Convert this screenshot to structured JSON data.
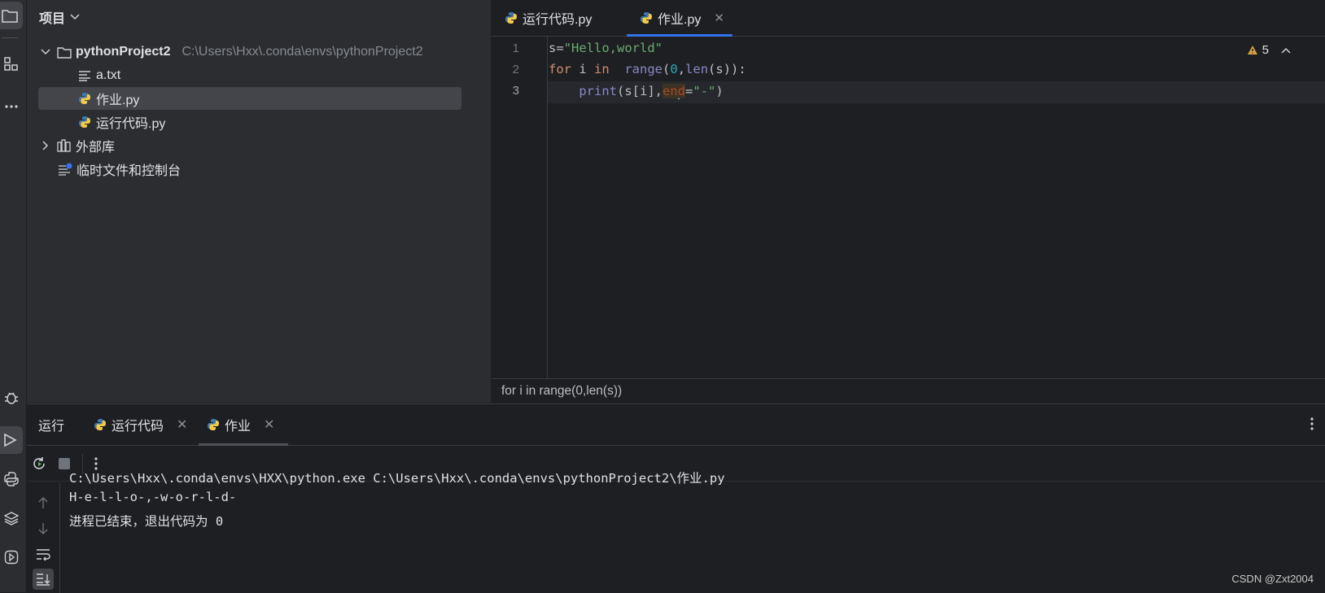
{
  "project_panel": {
    "title": "项目",
    "tree": {
      "root_name": "pythonProject2",
      "root_path": "C:\\Users\\Hxx\\.conda\\envs\\pythonProject2",
      "files": [
        "a.txt",
        "作业.py",
        "运行代码.py"
      ],
      "external_libs": "外部库",
      "scratches": "临时文件和控制台"
    }
  },
  "editor": {
    "tabs": [
      "运行代码.py",
      "作业.py"
    ],
    "active_tab": "作业.py",
    "line_numbers": [
      "1",
      "2",
      "3"
    ],
    "code": {
      "line1": {
        "var": "s",
        "eq": "=",
        "str": "\"Hello,world\""
      },
      "line2": {
        "kw_for": "for",
        "i": " i ",
        "kw_in": "in",
        "sp": "  ",
        "fn_range": "range",
        "open": "(",
        "num0": "0",
        "comma": ",",
        "fn_len": "len",
        "rest": "(s)):"
      },
      "line3": {
        "indent": "    ",
        "fn_print": "print",
        "args": "(s[i],",
        "param_a": "en",
        "param_b": "d",
        "eq": "=",
        "str": "\"-\"",
        "close": ")"
      }
    },
    "warnings_count": "5",
    "breadcrumb": "for i in range(0,len(s))"
  },
  "run_panel": {
    "label": "运行",
    "tabs": [
      "运行代码",
      "作业"
    ],
    "console": [
      "C:\\Users\\Hxx\\.conda\\envs\\HXX\\python.exe C:\\Users\\Hxx\\.conda\\envs\\pythonProject2\\作业.py",
      "H-e-l-l-o-,-w-o-r-l-d-",
      "进程已结束，退出代码为 0"
    ]
  },
  "watermark": "CSDN @Zxt2004"
}
